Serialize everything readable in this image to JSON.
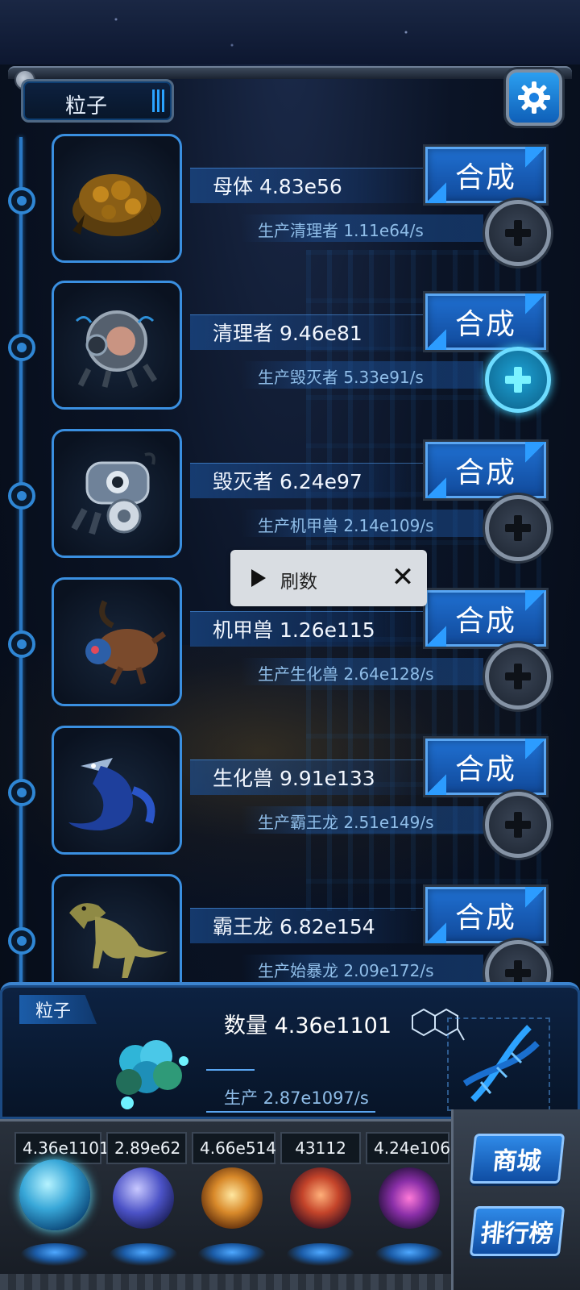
{
  "header": {
    "tab_label": "粒子",
    "settings_icon": "gear-icon"
  },
  "creatures": [
    {
      "name": "母体 4.83e56",
      "production": "生产清理者 1.11e64/s",
      "merge_label": "合成",
      "plus_active": false,
      "art": "rock-mother-icon"
    },
    {
      "name": "清理者 9.46e81",
      "production": "生产毁灭者 5.33e91/s",
      "merge_label": "合成",
      "plus_active": true,
      "art": "cleaner-creature-icon"
    },
    {
      "name": "毁灭者 6.24e97",
      "production": "生产机甲兽 2.14e109/s",
      "merge_label": "合成",
      "plus_active": false,
      "art": "destroyer-mech-icon"
    },
    {
      "name": "机甲兽 1.26e115",
      "production": "生产生化兽 2.64e128/s",
      "merge_label": "合成",
      "plus_active": false,
      "art": "mech-beast-icon"
    },
    {
      "name": "生化兽 9.91e133",
      "production": "生产霸王龙 2.51e149/s",
      "merge_label": "合成",
      "plus_active": false,
      "art": "biochem-dragon-icon"
    },
    {
      "name": "霸王龙 6.82e154",
      "production": "生产始暴龙 2.09e172/s",
      "merge_label": "合成",
      "plus_active": false,
      "art": "t-rex-icon"
    }
  ],
  "toast": {
    "label": "刷数",
    "play_icon": "play-icon",
    "close_icon": "close-icon"
  },
  "particle_panel": {
    "tab_label": "粒子",
    "quantity": "数量 4.36e1101",
    "production": "生产 2.87e1097/s"
  },
  "resources": [
    "4.36e1101",
    "2.89e62",
    "4.66e514",
    "43112",
    "4.24e106"
  ],
  "resource_orbs": [
    "particle-orb-icon",
    "lightning-orb-icon",
    "fire-orb-icon",
    "brain-orb-icon",
    "vortex-orb-icon"
  ],
  "side_buttons": {
    "shop": "商城",
    "leaderboard": "排行榜"
  },
  "colors": {
    "accent": "#2c9cff",
    "panel": "#0d2242",
    "merge_button": "#1f6fd0"
  }
}
